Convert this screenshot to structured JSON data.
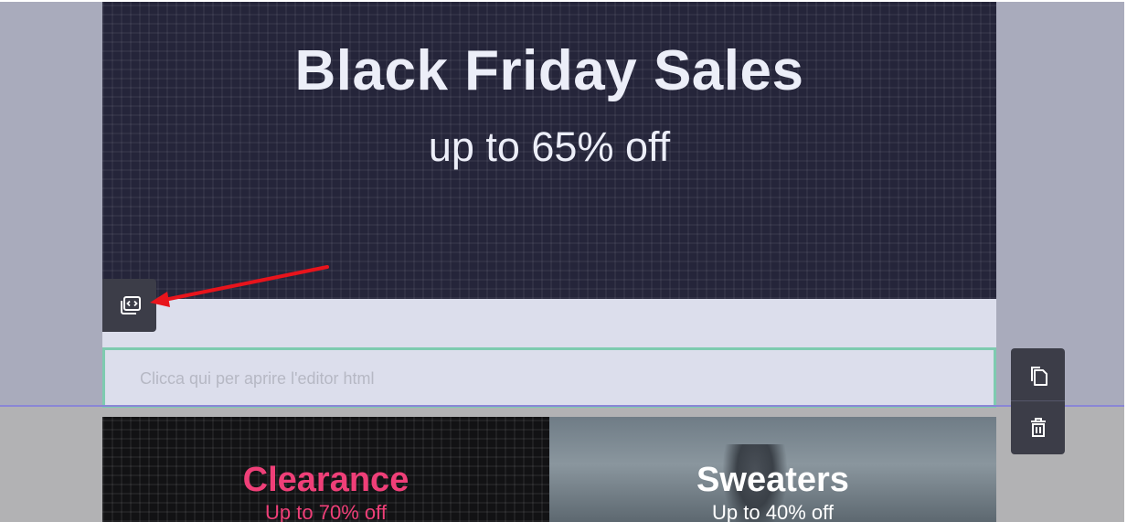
{
  "hero": {
    "title": "Black Friday Sales",
    "subtitle": "up to 65% off"
  },
  "html_block": {
    "placeholder": "Clicca qui per aprire l'editor html"
  },
  "handle": {
    "icon": "code-block-icon"
  },
  "toolbar": {
    "icons": [
      "copy-icon",
      "trash-icon"
    ]
  },
  "promos": [
    {
      "title": "Clearance",
      "subtitle": "Up to 70% off",
      "color": "#ef3f78"
    },
    {
      "title": "Sweaters",
      "subtitle": "Up to 40% off",
      "color": "#ffffff"
    }
  ],
  "annotation": {
    "color": "#e8141c"
  }
}
